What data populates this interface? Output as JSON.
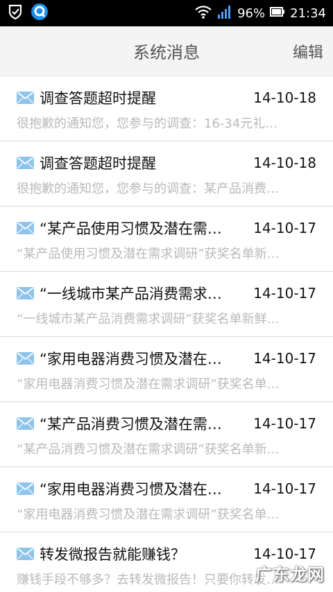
{
  "status_bar": {
    "battery_percent": "96%",
    "time": "21:34"
  },
  "header": {
    "title": "系统消息",
    "edit_label": "编辑"
  },
  "messages": [
    {
      "title": "调查答题超时提醒",
      "date": "14-10-18",
      "preview": "很抱歉的通知您，您参与的调查：16-34元礼…"
    },
    {
      "title": "调查答题超时提醒",
      "date": "14-10-18",
      "preview": "很抱歉的通知您，您参与的调查：某产品消费…"
    },
    {
      "title": "“某产品使用习惯及潜在需…",
      "date": "14-10-17",
      "preview": "“某产品使用习惯及潜在需求调研”获奖名单新…"
    },
    {
      "title": "“一线城市某产品消费需求…",
      "date": "14-10-17",
      "preview": "“一线城市某产品消费需求调研”获奖名单新鲜…"
    },
    {
      "title": "“家用电器消费习惯及潜在…",
      "date": "14-10-17",
      "preview": "“家用电器消费习惯及潜在需求调研”获奖名单…"
    },
    {
      "title": "“某产品消费习惯及潜在需…",
      "date": "14-10-17",
      "preview": "“某产品消费习惯及潜在需求调研”获奖名单新…"
    },
    {
      "title": "“家用电器消费习惯及潜在…",
      "date": "14-10-17",
      "preview": "“家用电器消费习惯及潜在需求调研”获奖名单…"
    },
    {
      "title": "转发微报告就能赚钱？",
      "date": "14-10-17",
      "preview": "赚钱手段不够多？去转发微报告！只要你转发…"
    }
  ],
  "watermark": "广东龙网",
  "colors": {
    "mail_icon": "#8ec3ea",
    "status_bar": "#000000",
    "header_bg": "#f4f4f4"
  }
}
